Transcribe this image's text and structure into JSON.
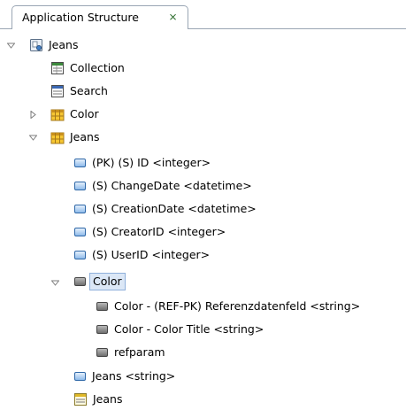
{
  "tab": {
    "title": "Application Structure"
  },
  "tree": {
    "root": "Jeans",
    "collection": "Collection",
    "search": "Search",
    "color_table": "Color",
    "jeans_table": "Jeans",
    "fields": [
      "(PK) (S) ID <integer>",
      "(S) ChangeDate <datetime>",
      "(S) CreationDate <datetime>",
      "(S) CreatorID <integer>",
      "(S) UserID <integer>"
    ],
    "color_group": "Color",
    "color_fields": [
      "Color - (REF-PK) Referenzdatenfeld <string>",
      "Color - Color Title <string>",
      "refparam"
    ],
    "jeans_field": "Jeans <string>",
    "jeans_form": "Jeans"
  }
}
